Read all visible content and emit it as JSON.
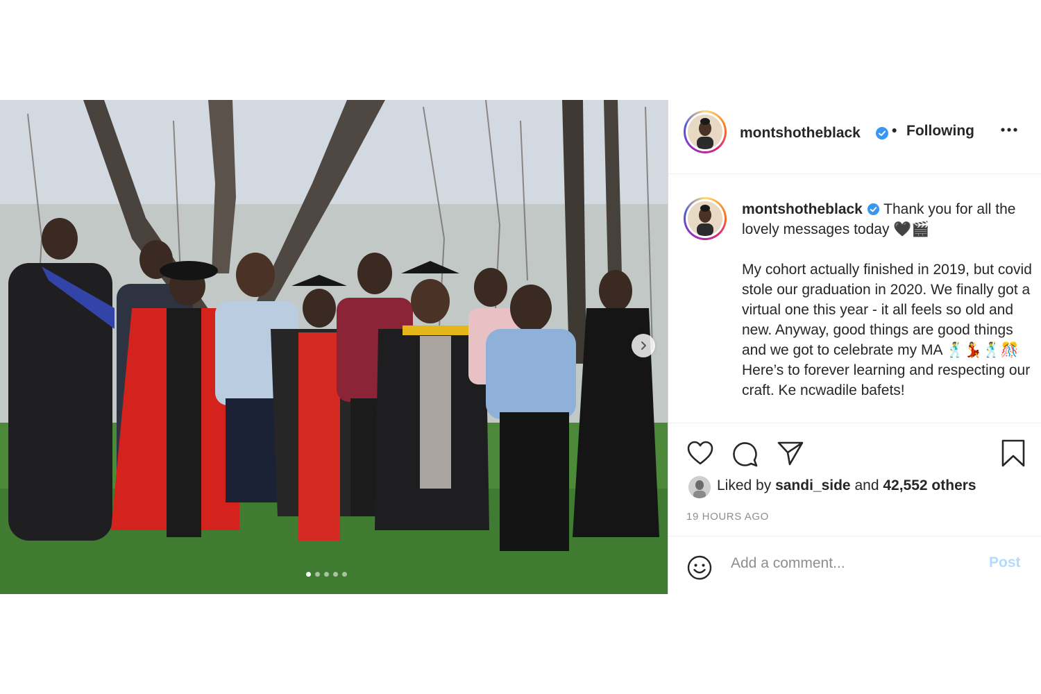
{
  "post": {
    "author": {
      "username": "montshotheblack",
      "verified": true,
      "follow_status": "Following"
    },
    "caption": {
      "username": "montshotheblack",
      "first_line": "Thank you for all the lovely messages today 🖤🎬",
      "body": "My cohort actually finished in 2019, but covid stole our graduation in 2020. We finally got a virtual one this year - it all feels so old and new. Anyway, good things are good things and we got to celebrate my MA 🕺💃🕺🎊 Here’s to forever learning and respecting our craft. Ke ncwadile bafets!"
    },
    "likes": {
      "prefix": "Liked by",
      "user": "sandi_side",
      "middle": "and",
      "count_text": "42,552 others"
    },
    "timestamp": "19 HOURS AGO",
    "comment": {
      "placeholder": "Add a comment...",
      "post_label": "Post"
    },
    "carousel": {
      "slide_count": 5,
      "active_index": 0
    },
    "icons": {
      "more": "more-options-icon",
      "like": "heart-icon",
      "comment": "comment-icon",
      "share": "share-icon",
      "save": "bookmark-icon",
      "emoji": "emoji-icon",
      "next": "chevron-right-icon"
    },
    "colors": {
      "verified": "#3897f0",
      "post_disabled": "#b3dbff",
      "secondary_text": "#8e8e8e"
    }
  }
}
